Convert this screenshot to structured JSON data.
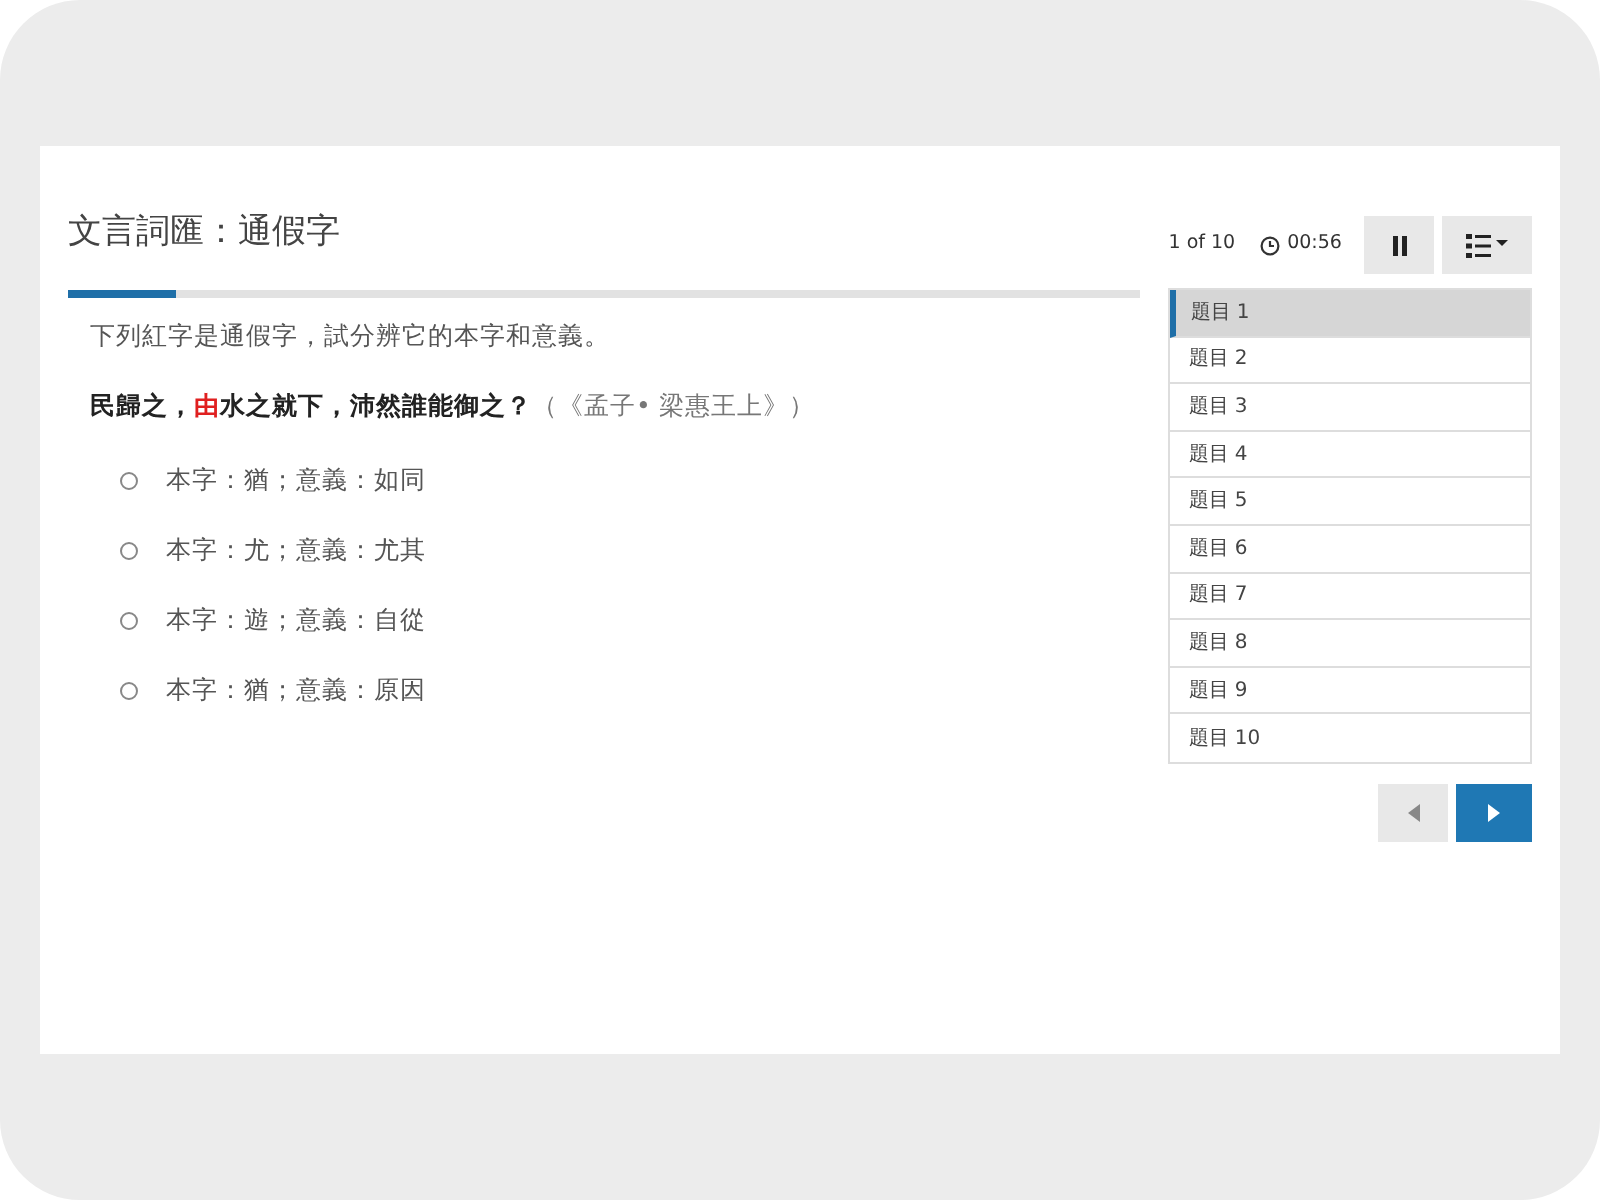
{
  "title": "文言詞匯：通假字",
  "progress": {
    "level": 0.1
  },
  "instruction": "下列紅字是通假字，試分辨它的本字和意義。",
  "question": [
    {
      "kind": "text",
      "text": "民歸之，"
    },
    {
      "kind": "highlight",
      "text": "由"
    },
    {
      "kind": "text",
      "text": "水之就下，沛然誰能御之？"
    },
    {
      "kind": "source",
      "text": "（《孟子• 梁惠王上》）"
    }
  ],
  "options": [
    {
      "label": "本字：猶；意義：如同",
      "selected": false
    },
    {
      "label": "本字：尤；意義：尤其",
      "selected": false
    },
    {
      "label": "本字：遊；意義：自從",
      "selected": false
    },
    {
      "label": "本字：猶；意義：原因",
      "selected": false
    }
  ],
  "counter": "1 of 10",
  "timer": "00:56",
  "questions": [
    {
      "label": "題目 1",
      "selected": true
    },
    {
      "label": "題目 2",
      "selected": false
    },
    {
      "label": "題目 3",
      "selected": false
    },
    {
      "label": "題目 4",
      "selected": false
    },
    {
      "label": "題目 5",
      "selected": false
    },
    {
      "label": "題目 6",
      "selected": false
    },
    {
      "label": "題目 7",
      "selected": false
    },
    {
      "label": "題目 8",
      "selected": false
    },
    {
      "label": "題目 9",
      "selected": false
    },
    {
      "label": "題目 10",
      "selected": false
    }
  ]
}
